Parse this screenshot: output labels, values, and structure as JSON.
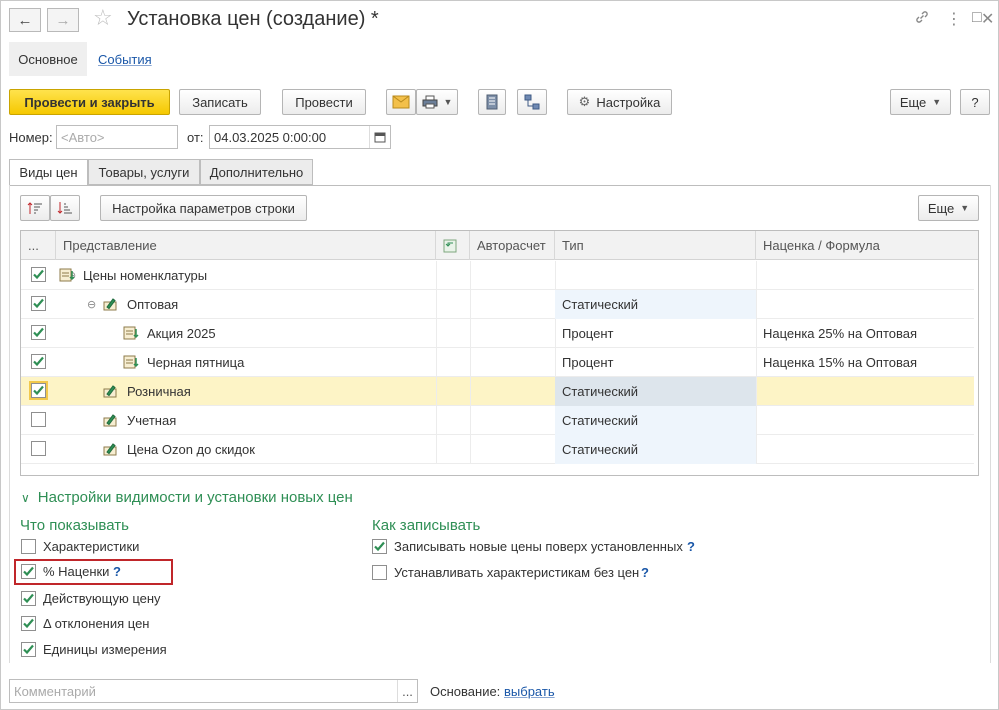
{
  "header": {
    "title": "Установка цен (создание) *"
  },
  "sections": {
    "main_label": "Основное",
    "events_label": "События"
  },
  "toolbar": {
    "post_close": "Провести и закрыть",
    "save": "Записать",
    "post": "Провести",
    "settings": "Настройка",
    "more": "Еще",
    "help": "?"
  },
  "form": {
    "number_label": "Номер:",
    "number_placeholder": "<Авто>",
    "date_label": "от:",
    "date_value": "04.03.2025  0:00:00"
  },
  "tabs": [
    "Виды цен",
    "Товары, услуги",
    "Дополнительно"
  ],
  "table_toolbar": {
    "row_settings": "Настройка параметров строки",
    "more": "Еще"
  },
  "table": {
    "columns": {
      "dots": "...",
      "repr": "Представление",
      "auto": "Авторасчет",
      "type": "Тип",
      "markup": "Наценка / Формула"
    },
    "rows": [
      {
        "checked": true,
        "name": "Цены номенклатуры",
        "type": "",
        "markup": ""
      },
      {
        "checked": true,
        "name": "Оптовая",
        "type": "Статический",
        "markup": ""
      },
      {
        "checked": true,
        "name": "Акция 2025",
        "type": "Процент",
        "markup": "Наценка 25% на Оптовая"
      },
      {
        "checked": true,
        "name": "Черная пятница",
        "type": "Процент",
        "markup": "Наценка 15% на Оптовая"
      },
      {
        "checked": true,
        "name": "Розничная",
        "type": "Статический",
        "markup": ""
      },
      {
        "checked": false,
        "name": "Учетная",
        "type": "Статический",
        "markup": ""
      },
      {
        "checked": false,
        "name": "Цена Ozon до скидок",
        "type": "Статический",
        "markup": ""
      }
    ]
  },
  "visibility": {
    "section_title": "Настройки видимости и установки новых цен",
    "show_title": "Что показывать",
    "write_title": "Как записывать",
    "show_options": [
      {
        "label": "Характеристики",
        "checked": false
      },
      {
        "label": "% Наценки",
        "checked": true
      },
      {
        "label": "Действующую цену",
        "checked": true
      },
      {
        "label": "Δ отклонения цен",
        "checked": true
      },
      {
        "label": "Единицы измерения",
        "checked": true
      }
    ],
    "write_options": [
      {
        "label": "Записывать новые цены поверх установленных",
        "checked": true
      },
      {
        "label": "Устанавливать характеристикам без цен",
        "checked": false
      }
    ],
    "help_mark": "?"
  },
  "footer": {
    "comment_placeholder": "Комментарий",
    "ellipsis": "...",
    "basis_label": "Основание:",
    "basis_link": "выбрать"
  }
}
